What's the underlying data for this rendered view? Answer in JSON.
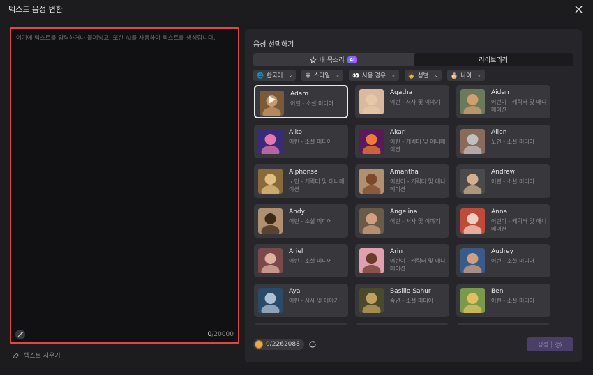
{
  "window": {
    "title": "텍스트 음성 변환"
  },
  "editor": {
    "placeholder": "여기에 텍스트를 입력하거나 붙여넣고, 또한 AI를 사용하여 텍스트를 생성합니다.",
    "count_current": "0",
    "count_max": "/20000",
    "clear_label": "텍스트 지우기"
  },
  "voices_panel": {
    "heading": "음성 선택하기",
    "tabs": [
      {
        "label": "내 목소리",
        "badge": "AI"
      },
      {
        "label": "라이브러리"
      }
    ],
    "filters": [
      {
        "icon": "globe-icon",
        "label": "한국어"
      },
      {
        "icon": "smile-icon",
        "label": "스타일"
      },
      {
        "icon": "eyes-icon",
        "label": "사용 경우"
      },
      {
        "icon": "person-icon",
        "label": "성별"
      },
      {
        "icon": "cake-icon",
        "label": "나이"
      }
    ],
    "voices": [
      {
        "name": "Adam",
        "desc": "어린 - 소셜 미디어",
        "bg": "#7a5a3a",
        "fg": "#c99a6b",
        "selected": true
      },
      {
        "name": "Agatha",
        "desc": "어린 - 서사 및 이야기",
        "bg": "#d9b9a0",
        "fg": "#e6c9a8"
      },
      {
        "name": "Aiden",
        "desc": "어린이 - 캐릭터 및 애니메이션",
        "bg": "#6a7a5a",
        "fg": "#d0a070"
      },
      {
        "name": "Aiko",
        "desc": "어린 - 소셜 미디어",
        "bg": "#3a2a7a",
        "fg": "#e27ab0"
      },
      {
        "name": "Akari",
        "desc": "어린 - 캐릭터 및 애니메이션",
        "bg": "#5a1a5a",
        "fg": "#f07a3a"
      },
      {
        "name": "Allen",
        "desc": "노인 - 소셜 미디어",
        "bg": "#8a6a5a",
        "fg": "#c0c0c0"
      },
      {
        "name": "Alphonse",
        "desc": "노인 - 캐릭터 및 애니메이션",
        "bg": "#8a6a3a",
        "fg": "#e0c080"
      },
      {
        "name": "Amantha",
        "desc": "어린이 - 캐릭터 및 애니메이션",
        "bg": "#b09070",
        "fg": "#7a4a2a"
      },
      {
        "name": "Andrew",
        "desc": "어린 - 소셜 미디어",
        "bg": "#4a4a4a",
        "fg": "#d0b090"
      },
      {
        "name": "Andy",
        "desc": "어린 - 소셜 미디어",
        "bg": "#b09070",
        "fg": "#3a2a1a"
      },
      {
        "name": "Angelina",
        "desc": "어린 - 서사 및 이야기",
        "bg": "#6a5a4a",
        "fg": "#d0a080"
      },
      {
        "name": "Anna",
        "desc": "어린이 - 캐릭터 및 애니메이션",
        "bg": "#c04a3a",
        "fg": "#f0d0c0"
      },
      {
        "name": "Ariel",
        "desc": "어린 - 소셜 미디어",
        "bg": "#7a4a4a",
        "fg": "#e0b0a0"
      },
      {
        "name": "Arin",
        "desc": "어린이 - 캐릭터 및 애니메이션",
        "bg": "#e0a0b0",
        "fg": "#6a3a2a"
      },
      {
        "name": "Audrey",
        "desc": "어린 - 소셜 미디어",
        "bg": "#3a5a8a",
        "fg": "#d0a080"
      },
      {
        "name": "Aya",
        "desc": "어린 - 서사 및 이야기",
        "bg": "#2a4a6a",
        "fg": "#b0c0d0"
      },
      {
        "name": "Basilio Sahur",
        "desc": "중년 - 소셜 미디어",
        "bg": "#4a4a2a",
        "fg": "#c0a060"
      },
      {
        "name": "Ben",
        "desc": "어린 - 소셜 미디어",
        "bg": "#7a9a4a",
        "fg": "#e0c060"
      }
    ]
  },
  "footer": {
    "credits_current": "0",
    "credits_total": "/2262088",
    "generate_label": "생성"
  },
  "colors": {
    "selection_border": "#e04646",
    "accent_ai": "#5b7bff",
    "credit": "#f0a43a"
  }
}
